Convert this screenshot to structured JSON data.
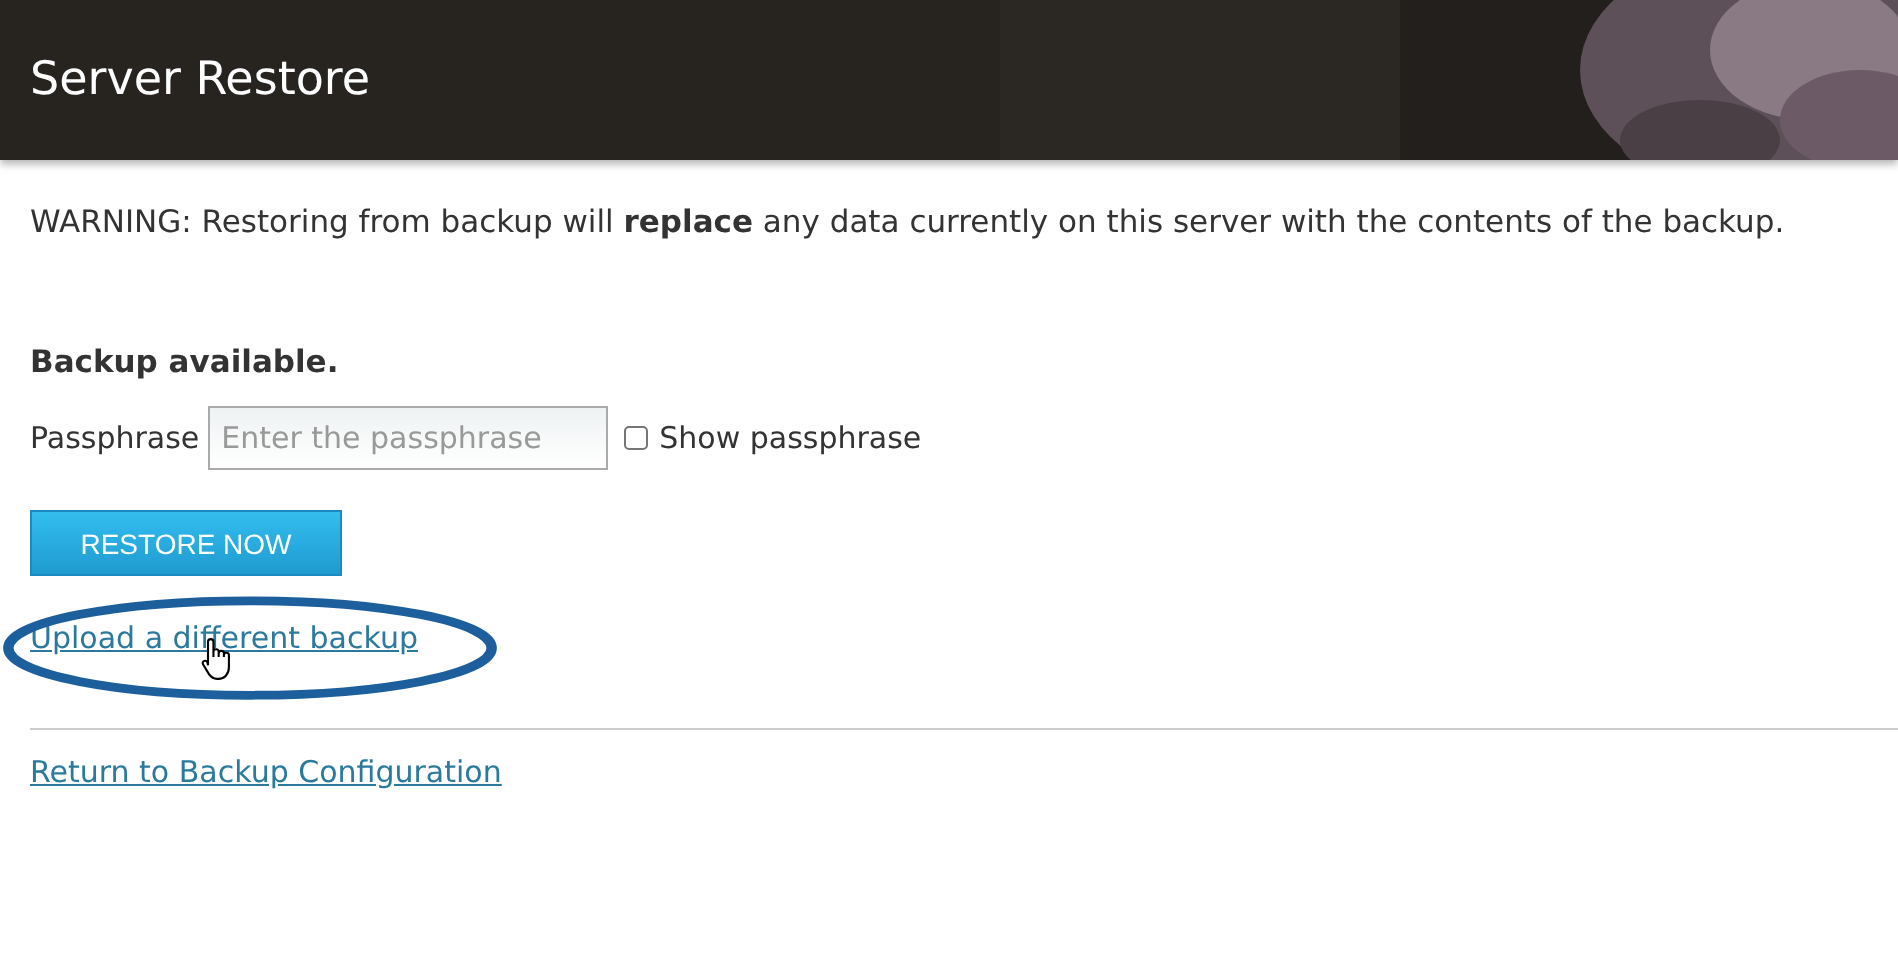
{
  "header": {
    "title": "Server Restore",
    "kind": "picture"
  },
  "warning": "WARNING: Restoring from backup will **replace** any data currently on this server with the contents of the backup.",
  "status": "Backup available.",
  "passphrase": {
    "label": "Passphrase",
    "placeholder": "Enter the passphrase"
  },
  "show_passphrase": {
    "label": "Show passphrase",
    "checked": false
  },
  "restore_button": "RESTORE NOW",
  "upload_link": "Upload a different backup",
  "return_link": "Return to Backup Configuration"
}
